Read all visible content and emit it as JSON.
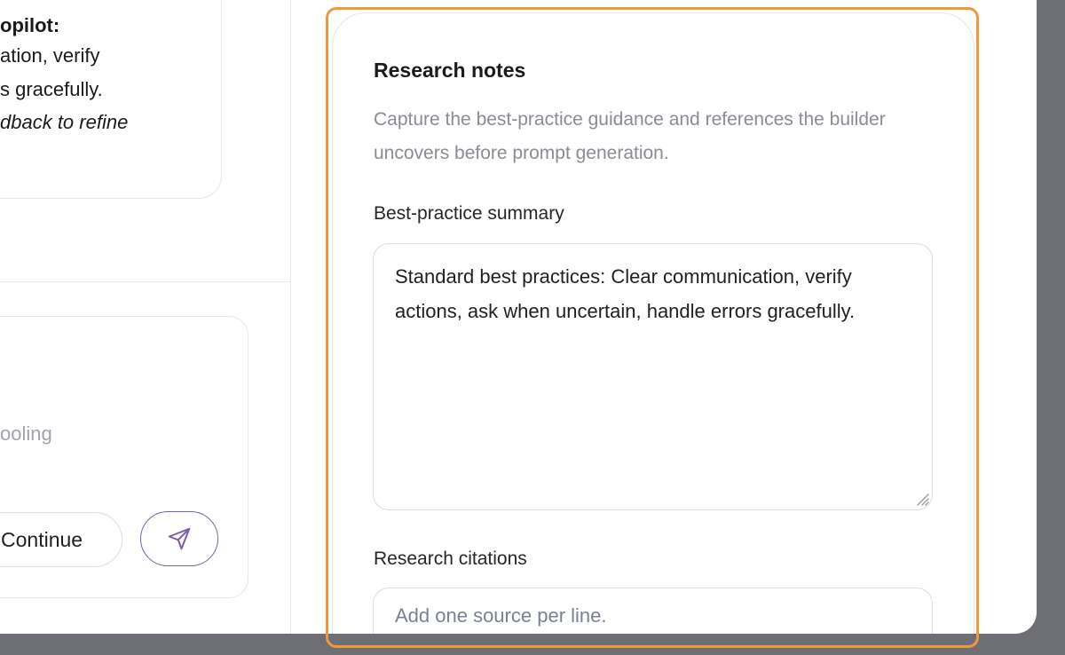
{
  "chat": {
    "message_lines": [
      {
        "text": "opilot:",
        "style": "bold"
      },
      {
        "text": "ation, verify",
        "style": "normal"
      },
      {
        "text": "s gracefully.",
        "style": "normal"
      },
      {
        "text": "dback to refine",
        "style": "italic"
      }
    ],
    "composer_placeholder": "ooling",
    "continue_label": "Continue",
    "send_icon": "send-icon"
  },
  "research": {
    "title": "Research notes",
    "description": "Capture the best-practice guidance and references the builder uncovers before prompt generation.",
    "summary_label": "Best-practice summary",
    "summary_value": "Standard best practices: Clear communication, verify actions, ask when uncertain, handle errors gracefully.",
    "citations_label": "Research citations",
    "citations_placeholder": "Add one source per line."
  },
  "colors": {
    "highlight": "#ee9a3a",
    "accent": "#7c5ea6",
    "backdrop": "#6e6f74"
  }
}
